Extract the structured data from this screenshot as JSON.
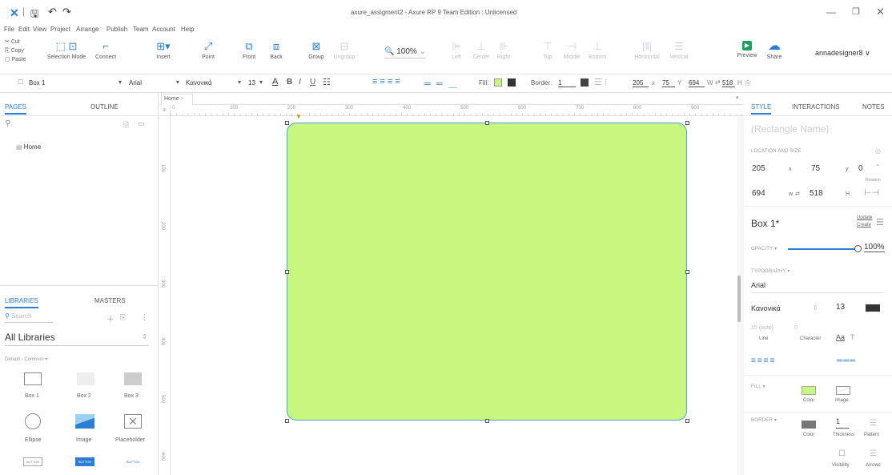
{
  "window": {
    "title": "axure_assigment2 - Axure RP 9 Team Edition : Unlicensed"
  },
  "menu": [
    "File",
    "Edit",
    "View",
    "Project",
    "Arrange",
    "Publish",
    "Team",
    "Account",
    "Help"
  ],
  "clipboard": {
    "cut": "Cut",
    "copy": "Copy",
    "paste": "Paste"
  },
  "toolbar": {
    "selection_mode": "Selection Mode",
    "connect": "Connect",
    "insert": "Insert",
    "point": "Point",
    "front": "Front",
    "back": "Back",
    "group": "Group",
    "ungroup": "Ungroup",
    "zoom": "100%",
    "left": "Left",
    "center": "Center",
    "right": "Right",
    "top": "Top",
    "middle": "Middle",
    "bottom": "Bottom",
    "horizontal": "Horizontal",
    "vertical": "Vertical",
    "preview": "Preview",
    "share": "Share",
    "user": "annadesigner8"
  },
  "format": {
    "widget": "Box 1",
    "font": "Arial",
    "style": "Κανονικά",
    "size": "13",
    "fill": "Fill:",
    "border": "Border:",
    "border_val": "1",
    "x": "205",
    "x_lbl": "x",
    "y": "75",
    "y_lbl": "Y",
    "w": "694",
    "w_lbl": "W",
    "h": "518",
    "h_lbl": "H"
  },
  "left": {
    "tab_pages": "PAGES",
    "tab_outline": "OUTLINE",
    "page": "Home",
    "tab_libraries": "LIBRARIES",
    "tab_masters": "MASTERS",
    "search_placeholder": "Search",
    "library": "All Libraries",
    "library_group": "Default › Common ▾",
    "widgets": [
      "Box 1",
      "Box 2",
      "Box 3",
      "Ellipse",
      "Image",
      "Placeholder",
      "BUTTON",
      "BUTTON",
      "BUTTON"
    ]
  },
  "canvas": {
    "tab": "Home",
    "ruler_h": [
      "0",
      "100",
      "200",
      "300",
      "400",
      "500",
      "600",
      "700",
      "800",
      "900"
    ],
    "ruler_v": [
      "100",
      "200",
      "300",
      "400",
      "500",
      "600"
    ],
    "box_color": "#c8f780",
    "box_border": "#4aa3df"
  },
  "right": {
    "tab_style": "STYLE",
    "tab_interactions": "INTERACTIONS",
    "tab_notes": "NOTES",
    "shape_name_placeholder": "(Rectangle Name)",
    "loc_title": "LOCATION AND SIZE",
    "x": "205",
    "y": "75",
    "rot": "0",
    "rot_lbl": "Rotation",
    "w": "694",
    "h": "518",
    "style_name": "Box 1*",
    "update": "Update",
    "create": "Create",
    "opacity_lbl": "OPACITY ▾",
    "opacity": "100%",
    "typo_lbl": "TYPOGRAPHY ▾",
    "font": "Arial",
    "weight": "Κανονικά",
    "size": "13",
    "line": "15 (auto)",
    "line_lbl": "Line",
    "char": "0",
    "char_lbl": "Character",
    "fill_lbl": "FILL ▾",
    "fill_color": "Color",
    "fill_image": "Image",
    "border_lbl": "BORDER ▾",
    "border_color": "Color",
    "thickness": "1",
    "thickness_lbl": "Thickness",
    "pattern_lbl": "Pattern",
    "visibility": "Visibility",
    "arrows": "Arrows"
  }
}
